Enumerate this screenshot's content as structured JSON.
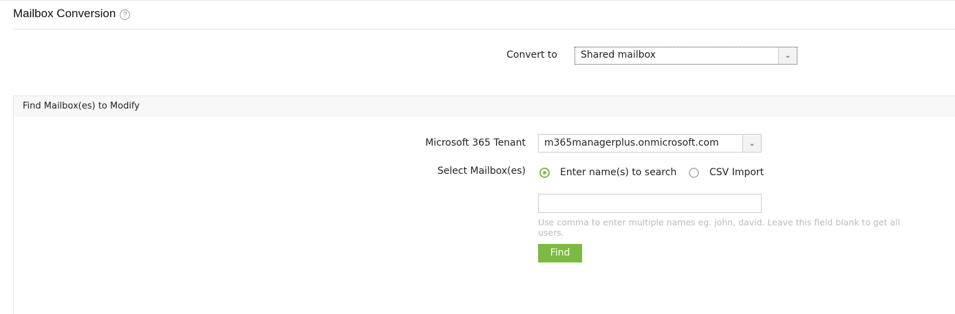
{
  "header": {
    "title": "Mailbox Conversion",
    "help_icon": "?"
  },
  "convert": {
    "label": "Convert to",
    "value": "Shared mailbox"
  },
  "panel": {
    "title": "Find Mailbox(es) to Modify",
    "tenant_label": "Microsoft 365 Tenant",
    "tenant_value": "m365managerplus.onmicrosoft.com",
    "select_label": "Select Mailbox(es)",
    "option_search": "Enter name(s) to search",
    "option_csv": "CSV Import",
    "search_value": "",
    "hint": "Use comma to enter multiple names eg. john, david. Leave this field blank to get all users.",
    "find_label": "Find"
  },
  "colors": {
    "accent": "#7dba44"
  }
}
